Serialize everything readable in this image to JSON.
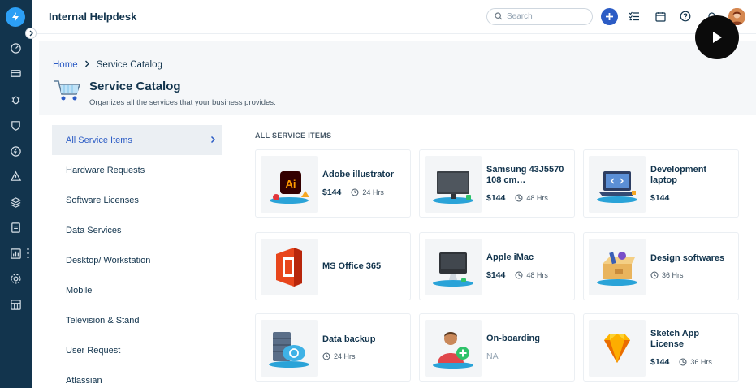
{
  "topbar": {
    "title": "Internal Helpdesk",
    "search_placeholder": "Search"
  },
  "breadcrumb": {
    "home": "Home",
    "current": "Service Catalog"
  },
  "page": {
    "title": "Service Catalog",
    "subtitle": "Organizes all the services that your business provides."
  },
  "categories": [
    {
      "label": "All Service Items",
      "active": true
    },
    {
      "label": "Hardware Requests"
    },
    {
      "label": "Software Licenses"
    },
    {
      "label": "Data Services"
    },
    {
      "label": "Desktop/ Workstation"
    },
    {
      "label": "Mobile"
    },
    {
      "label": "Television & Stand"
    },
    {
      "label": "User Request"
    },
    {
      "label": "Atlassian"
    }
  ],
  "section_label": "ALL SERVICE ITEMS",
  "items": [
    {
      "name": "Adobe illustrator",
      "price": "$144",
      "sla": "24 Hrs",
      "icon": "adobe-illustrator-icon"
    },
    {
      "name": "Samsung 43J5570 108 cm…",
      "price": "$144",
      "sla": "48 Hrs",
      "icon": "television-icon"
    },
    {
      "name": "Development laptop",
      "price": "$144",
      "sla": "",
      "icon": "laptop-icon"
    },
    {
      "name": "MS Office 365",
      "price": "",
      "sla": "",
      "icon": "ms-office-icon"
    },
    {
      "name": "Apple iMac",
      "price": "$144",
      "sla": "48 Hrs",
      "icon": "imac-icon"
    },
    {
      "name": "Design softwares",
      "price": "",
      "sla": "36 Hrs",
      "icon": "design-box-icon"
    },
    {
      "name": "Data backup",
      "price": "",
      "sla": "24 Hrs",
      "icon": "cloud-backup-icon"
    },
    {
      "name": "On-boarding",
      "price": "",
      "sla": "",
      "na": "NA",
      "icon": "user-add-icon"
    },
    {
      "name": "Sketch App License",
      "price": "$144",
      "sla": "36 Hrs",
      "icon": "sketch-diamond-icon"
    }
  ],
  "colors": {
    "rail": "#12344d",
    "accent": "#2c5cc5",
    "band": "#f5f7f9"
  }
}
